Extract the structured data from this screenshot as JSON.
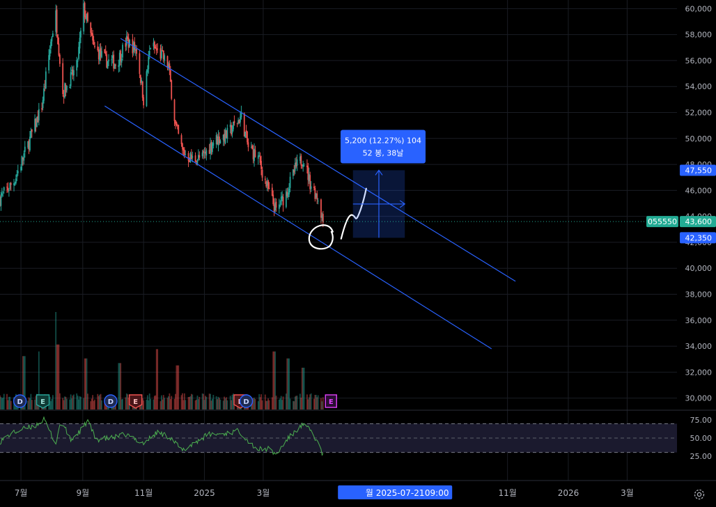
{
  "chart_data": {
    "type": "candlestick",
    "symbol_code": "055550",
    "price_axis": {
      "ylim": [
        29500,
        60500
      ],
      "ticks": [
        30000,
        32000,
        34000,
        36000,
        38000,
        40000,
        42000,
        44000,
        46000,
        48000,
        50000,
        52000,
        54000,
        56000,
        58000,
        60000
      ],
      "tick_labels": [
        "30,000",
        "32,000",
        "34,000",
        "36,000",
        "38,000",
        "40,000",
        "42,000",
        "44,000",
        "46,000",
        "48,000",
        "50,000",
        "52,000",
        "54,000",
        "56,000",
        "58,000",
        "60,000"
      ]
    },
    "time_axis": {
      "range": [
        "2024-06-10",
        "2026-04-20"
      ],
      "ticks": [
        {
          "date": "2024-07-01",
          "label": "7월"
        },
        {
          "date": "2024-09-01",
          "label": "9월"
        },
        {
          "date": "2024-11-01",
          "label": "11월"
        },
        {
          "date": "2025-01-01",
          "label": "2025"
        },
        {
          "date": "2025-03-01",
          "label": "3월"
        },
        {
          "date": "2025-11-01",
          "label": "11월"
        },
        {
          "date": "2026-01-01",
          "label": "2026"
        },
        {
          "date": "2026-03-01",
          "label": "3월"
        }
      ],
      "crosshair_labels": [
        "금 2025-0",
        "월 2025-07-21",
        "09:00"
      ]
    },
    "price_path": [
      [
        "2024-06-10",
        45400
      ],
      [
        "2024-06-24",
        46700
      ],
      [
        "2024-07-08",
        49500
      ],
      [
        "2024-07-22",
        52500
      ],
      [
        "2024-08-01",
        58000
      ],
      [
        "2024-08-05",
        59500
      ],
      [
        "2024-08-12",
        53500
      ],
      [
        "2024-08-26",
        55500
      ],
      [
        "2024-09-02",
        60000
      ],
      [
        "2024-09-12",
        57000
      ],
      [
        "2024-09-24",
        56000
      ],
      [
        "2024-10-05",
        55800
      ],
      [
        "2024-10-15",
        57500
      ],
      [
        "2024-10-25",
        56800
      ],
      [
        "2024-11-01",
        53000
      ],
      [
        "2024-11-08",
        57200
      ],
      [
        "2024-11-20",
        56300
      ],
      [
        "2024-11-26",
        55500
      ],
      [
        "2024-12-03",
        51000
      ],
      [
        "2024-12-10",
        49000
      ],
      [
        "2024-12-20",
        48400
      ],
      [
        "2024-12-30",
        48500
      ],
      [
        "2025-01-10",
        49800
      ],
      [
        "2025-01-24",
        50300
      ],
      [
        "2025-02-07",
        51700
      ],
      [
        "2025-02-14",
        49300
      ],
      [
        "2025-02-24",
        48500
      ],
      [
        "2025-03-05",
        46200
      ],
      [
        "2025-03-14",
        44400
      ],
      [
        "2025-03-24",
        45800
      ],
      [
        "2025-04-03",
        47800
      ],
      [
        "2025-04-10",
        48500
      ],
      [
        "2025-04-17",
        46600
      ],
      [
        "2025-04-25",
        45400
      ],
      [
        "2025-04-30",
        43600
      ]
    ],
    "volume_spikes": [
      [
        "2024-07-04",
        2.3
      ],
      [
        "2024-07-20",
        2.5
      ],
      [
        "2024-08-05",
        4.2
      ],
      [
        "2024-08-07",
        2.8
      ],
      [
        "2024-09-04",
        2.2
      ],
      [
        "2024-10-08",
        2.0
      ],
      [
        "2024-11-15",
        2.6
      ],
      [
        "2024-12-05",
        1.9
      ],
      [
        "2025-03-12",
        2.5
      ],
      [
        "2025-03-26",
        2.2
      ],
      [
        "2025-04-10",
        1.8
      ]
    ],
    "rsi": {
      "ticks": [
        25,
        50,
        75
      ],
      "tick_labels": [
        "25.00",
        "50.00",
        "75.00"
      ],
      "bands": [
        30,
        70
      ],
      "path": [
        [
          "2024-06-10",
          45
        ],
        [
          "2024-06-20",
          55
        ],
        [
          "2024-07-02",
          62
        ],
        [
          "2024-07-15",
          67
        ],
        [
          "2024-07-24",
          76
        ],
        [
          "2024-08-05",
          42
        ],
        [
          "2024-08-10",
          75
        ],
        [
          "2024-08-20",
          47
        ],
        [
          "2024-08-31",
          62
        ],
        [
          "2024-09-06",
          74
        ],
        [
          "2024-09-14",
          48
        ],
        [
          "2024-09-30",
          50
        ],
        [
          "2024-10-14",
          55
        ],
        [
          "2024-11-01",
          43
        ],
        [
          "2024-11-15",
          58
        ],
        [
          "2024-11-28",
          51
        ],
        [
          "2024-12-10",
          32
        ],
        [
          "2024-12-20",
          42
        ],
        [
          "2025-01-05",
          55
        ],
        [
          "2025-01-20",
          56
        ],
        [
          "2025-02-05",
          60
        ],
        [
          "2025-02-16",
          43
        ],
        [
          "2025-02-24",
          34
        ],
        [
          "2025-03-06",
          35
        ],
        [
          "2025-03-14",
          27
        ],
        [
          "2025-03-25",
          48
        ],
        [
          "2025-04-04",
          62
        ],
        [
          "2025-04-10",
          68
        ],
        [
          "2025-04-18",
          60
        ],
        [
          "2025-04-26",
          40
        ],
        [
          "2025-04-30",
          26
        ]
      ]
    },
    "channel": {
      "upper": [
        [
          "2024-10-09",
          57700
        ],
        [
          "2025-11-09",
          39000
        ]
      ],
      "lower": [
        [
          "2024-09-23",
          52500
        ],
        [
          "2025-10-16",
          33800
        ]
      ]
    },
    "measure_tool": {
      "start": [
        "2025-05-30",
        42350
      ],
      "end": [
        "2025-07-21",
        47550
      ],
      "label_line1": "5,200 (12.27%) 104",
      "label_line2": "52 봉, 38날",
      "high_label": "47,550",
      "low_label": "42,350"
    },
    "last_price": 43600,
    "last_price_label": "43,600",
    "event_markers": [
      {
        "date": "2024-06-30",
        "letter": "D",
        "kind": "dividend"
      },
      {
        "date": "2024-07-23",
        "letter": "E",
        "kind": "earnings-past"
      },
      {
        "date": "2024-09-29",
        "letter": "D",
        "kind": "dividend"
      },
      {
        "date": "2024-10-24",
        "letter": "E",
        "kind": "earnings-missed"
      },
      {
        "date": "2025-02-06",
        "letter": "E",
        "kind": "earnings-missed"
      },
      {
        "date": "2025-02-12",
        "letter": "D",
        "kind": "dividend"
      },
      {
        "date": "2025-05-08",
        "letter": "E",
        "kind": "earnings-upcoming"
      }
    ],
    "colors": {
      "background": "#000000",
      "up": "#26a69a",
      "down": "#ef5350",
      "grid": "#1a1d24",
      "axis_text": "#b2b5be",
      "channel": "#2962ff",
      "measure_label_bg": "#2962ff",
      "last_price_badge": "#22ab94",
      "rsi_line": "#4caf50",
      "rsi_band_fill": "#1b1a2e"
    }
  }
}
